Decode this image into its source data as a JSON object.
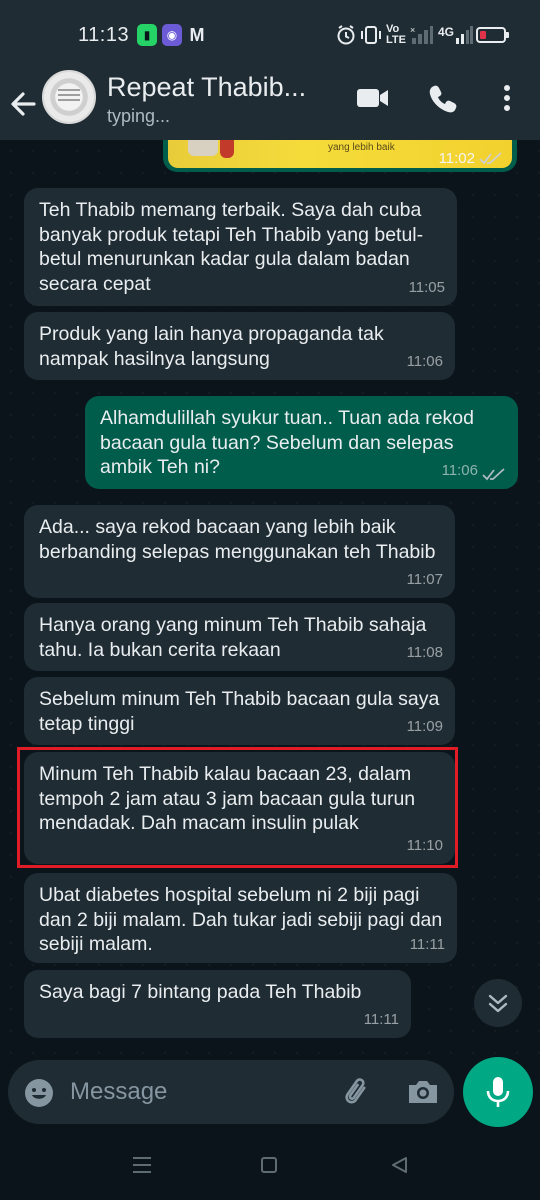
{
  "status_bar": {
    "time": "11:13",
    "app_icons": [
      "phone-battery-icon",
      "game-icon",
      "gmail-icon"
    ],
    "volte": "Vo LTE",
    "network": "4G"
  },
  "header": {
    "contact_name": "Repeat Thabib...",
    "status": "typing..."
  },
  "chat": {
    "image_message": {
      "time": "11:02",
      "caption": "yang lebih baik"
    },
    "messages": [
      {
        "dir": "in",
        "text": "Teh Thabib memang terbaik. Saya dah cuba banyak produk tetapi Teh Thabib yang betul-betul menurunkan kadar gula dalam badan secara cepat",
        "time": "11:05"
      },
      {
        "dir": "in",
        "text": "Produk yang lain hanya propaganda tak nampak hasilnya langsung",
        "time": "11:06"
      },
      {
        "dir": "out",
        "text": "Alhamdulillah syukur tuan.. Tuan ada rekod bacaan gula tuan? Sebelum dan selepas ambik Teh ni?",
        "time": "11:06"
      },
      {
        "dir": "in",
        "text": "Ada... saya rekod bacaan yang lebih baik berbanding selepas menggunakan teh Thabib",
        "time": "11:07"
      },
      {
        "dir": "in",
        "text": "Hanya orang yang minum Teh Thabib sahaja tahu. Ia bukan cerita rekaan",
        "time": "11:08"
      },
      {
        "dir": "in",
        "text": "Sebelum minum Teh Thabib bacaan gula saya tetap tinggi",
        "time": "11:09"
      },
      {
        "dir": "in",
        "text": "Minum Teh Thabib kalau bacaan 23, dalam tempoh 2 jam atau 3 jam bacaan gula turun mendadak. Dah macam insulin pulak",
        "time": "11:10"
      },
      {
        "dir": "in",
        "text": "Ubat diabetes hospital sebelum ni 2 biji pagi dan 2 biji malam. Dah tukar jadi sebiji pagi dan sebiji malam.",
        "time": "11:11"
      },
      {
        "dir": "in",
        "text": "Saya bagi 7 bintang pada Teh Thabib",
        "time": "11:11"
      }
    ]
  },
  "input": {
    "placeholder": "Message"
  },
  "colors": {
    "background": "#0b141a",
    "incoming_bubble": "#1f2c34",
    "outgoing_bubble": "#005c4b",
    "accent": "#00a884",
    "highlight_border": "#e01d26"
  }
}
